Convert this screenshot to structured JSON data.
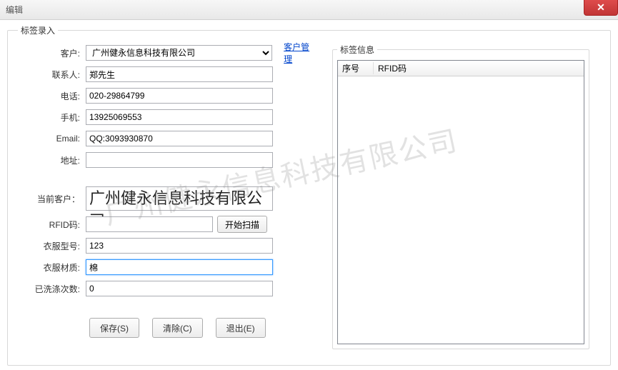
{
  "window": {
    "title": "编辑"
  },
  "fieldset": {
    "legend": "标签录入",
    "customer_label": "客户:",
    "contact_label": "联系人:",
    "phone_label": "电话:",
    "mobile_label": "手机:",
    "email_label": "Email:",
    "address_label": "地址:",
    "current_customer_label": "当前客户：",
    "rfid_label": "RFID码:",
    "model_label": "衣服型号:",
    "material_label": "衣服材质:",
    "wash_count_label": "已洗涤次数:"
  },
  "values": {
    "customer": "广州健永信息科技有限公司",
    "contact": "郑先生",
    "phone": "020-29864799",
    "mobile": "13925069553",
    "email": "QQ:3093930870",
    "address": "",
    "current_customer": "广州健永信息科技有限公司",
    "rfid": "",
    "model": "123",
    "material": "棉",
    "wash_count": "0"
  },
  "actions": {
    "manage_link": "客户管理",
    "scan": "开始扫描",
    "save": "保存(S)",
    "clear": "清除(C)",
    "exit": "退出(E)"
  },
  "tag_panel": {
    "legend": "标签信息",
    "col_seq": "序号",
    "col_rfid": "RFID码"
  },
  "watermark": "广州健永信息科技有限公司"
}
